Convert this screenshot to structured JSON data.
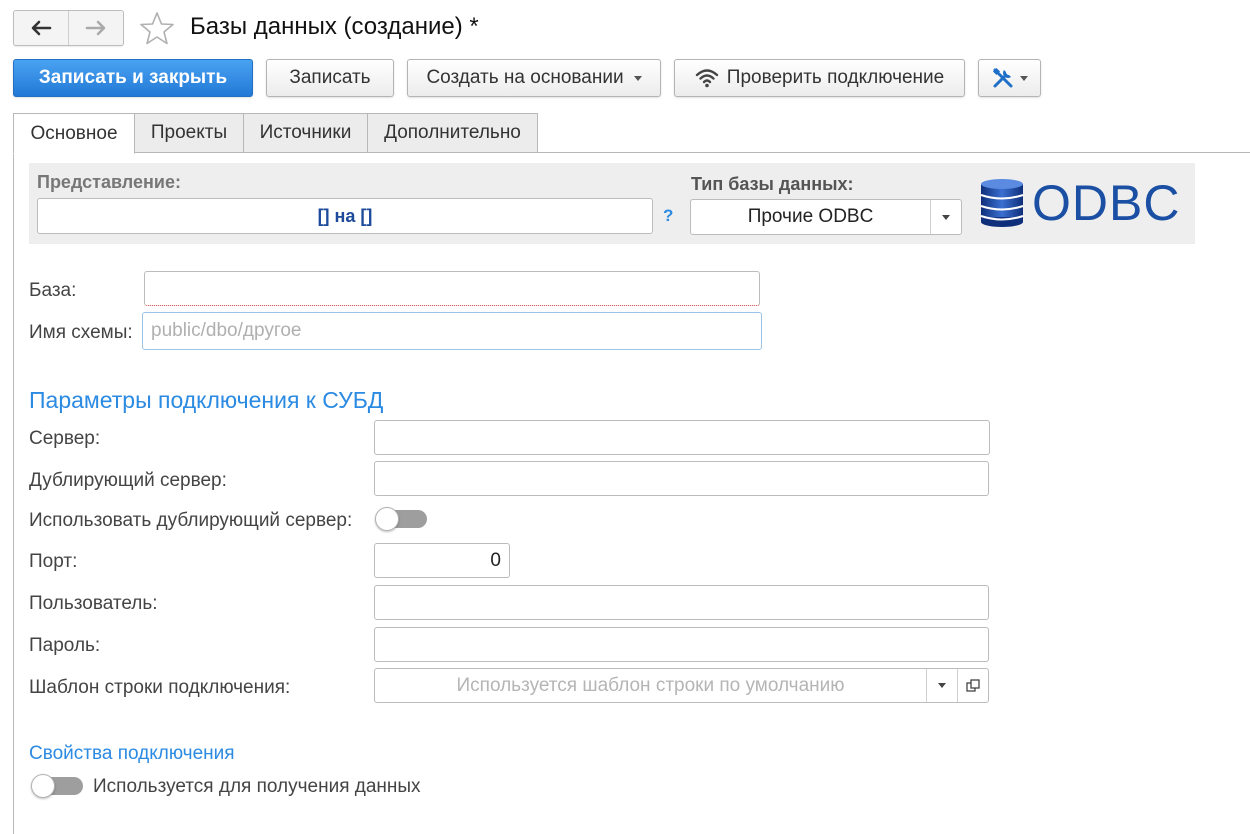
{
  "header": {
    "title": "Базы данных (создание) *"
  },
  "toolbar": {
    "save_close": "Записать и закрыть",
    "save": "Записать",
    "create_based": "Создать на основании",
    "check_connection": "Проверить подключение"
  },
  "tabs": [
    {
      "label": "Основное",
      "active": true
    },
    {
      "label": "Проекты",
      "active": false
    },
    {
      "label": "Источники",
      "active": false
    },
    {
      "label": "Дополнительно",
      "active": false
    }
  ],
  "panel": {
    "representation_label": "Представление:",
    "representation_value": "[] на []",
    "help": "?",
    "db_type_label": "Тип базы данных:",
    "db_type_value": "Прочие ODBC",
    "logo_text": "ODBC"
  },
  "form": {
    "base_label": "База:",
    "base_value": "",
    "schema_label": "Имя схемы:",
    "schema_placeholder": "public/dbo/другое"
  },
  "connection": {
    "section_title": "Параметры подключения к СУБД",
    "server_label": "Сервер:",
    "server_value": "",
    "backup_server_label": "Дублирующий сервер:",
    "backup_server_value": "",
    "use_backup_label": "Использовать дублирующий сервер:",
    "use_backup_on": false,
    "port_label": "Порт:",
    "port_value": "0",
    "user_label": "Пользователь:",
    "user_value": "",
    "password_label": "Пароль:",
    "password_value": "",
    "template_label": "Шаблон строки подключения:",
    "template_placeholder": "Используется шаблон строки по умолчанию"
  },
  "properties": {
    "section_title": "Свойства подключения",
    "used_for_data_label": "Используется для получения данных",
    "used_for_data_on": false
  },
  "icons": {
    "back": "arrow-left-icon",
    "forward": "arrow-right-icon",
    "favorite": "star-icon",
    "wifi": "wifi-icon",
    "tools": "tools-icon",
    "database": "database-icon",
    "open": "open-window-icon"
  },
  "colors": {
    "accent": "#2b8ae2",
    "primary_button": "#2a82df",
    "link_blue": "#1d4a9a",
    "odbc_blue": "#1a4fa3"
  }
}
